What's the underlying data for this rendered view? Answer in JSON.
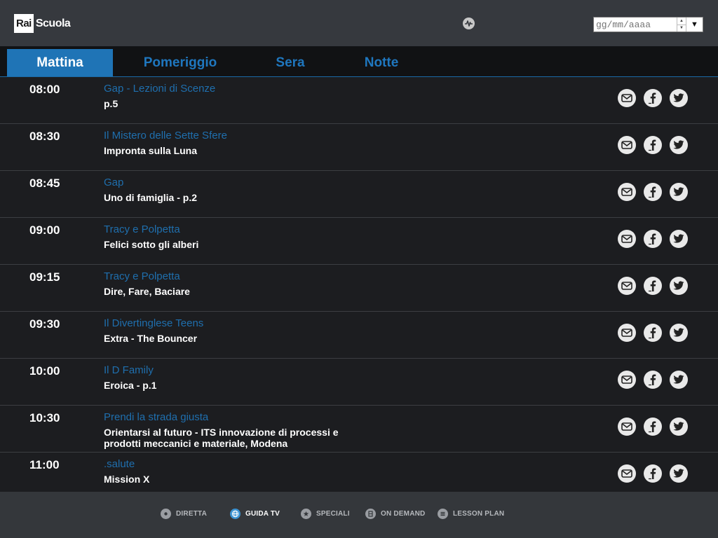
{
  "brand": {
    "logo_box": "Rai",
    "logo_text": "Scuola"
  },
  "date_picker": {
    "placeholder": "gg/mm/aaaa",
    "value": ""
  },
  "tabs": [
    {
      "label": "Mattina",
      "active": true
    },
    {
      "label": "Pomeriggio",
      "active": false
    },
    {
      "label": "Sera",
      "active": false
    },
    {
      "label": "Notte",
      "active": false
    }
  ],
  "schedule": [
    {
      "time": "08:00",
      "show": "Gap - Lezioni di Scenze",
      "episode": "p.5"
    },
    {
      "time": "08:30",
      "show": "Il Mistero delle Sette Sfere",
      "episode": "Impronta sulla Luna"
    },
    {
      "time": "08:45",
      "show": "Gap",
      "episode": "Uno di famiglia - p.2"
    },
    {
      "time": "09:00",
      "show": "Tracy e Polpetta",
      "episode": "Felici sotto gli alberi"
    },
    {
      "time": "09:15",
      "show": "Tracy e Polpetta",
      "episode": "Dire, Fare, Baciare"
    },
    {
      "time": "09:30",
      "show": "Il Divertinglese Teens",
      "episode": "Extra - The Bouncer"
    },
    {
      "time": "10:00",
      "show": "Il D Family",
      "episode": "Eroica - p.1"
    },
    {
      "time": "10:30",
      "show": "Prendi la strada giusta",
      "episode": "Orientarsi al futuro - ITS innovazione di processi e prodotti meccanici e materiale, Modena"
    },
    {
      "time": "11:00",
      "show": ".salute",
      "episode": "Mission X"
    }
  ],
  "share_icons": [
    "mail-icon",
    "facebook-icon",
    "twitter-icon"
  ],
  "bottom_nav": [
    {
      "label": "DIRETTA",
      "icon": "live-icon",
      "active": false
    },
    {
      "label": "GUIDA TV",
      "icon": "globe-icon",
      "active": true
    },
    {
      "label": "SPECIALI",
      "icon": "star-icon",
      "active": false
    },
    {
      "label": "ON DEMAND",
      "icon": "film-icon",
      "active": false
    },
    {
      "label": "LESSON PLAN",
      "icon": "list-icon",
      "active": false
    }
  ],
  "colors": {
    "accent": "#1f74b6",
    "link": "#1f6fae",
    "header_bg": "#36393e",
    "list_bg": "#1c1d20"
  }
}
